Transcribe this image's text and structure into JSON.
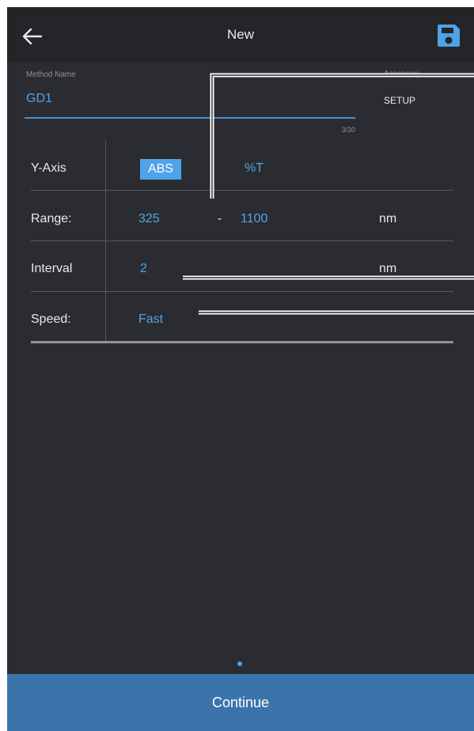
{
  "appbar": {
    "title": "New",
    "back_icon": "arrow-left-icon",
    "save_icon": "save-icon"
  },
  "method_name": {
    "label": "Method Name",
    "value": "GD1",
    "counter": "3/30"
  },
  "accessory": {
    "label": "Accessory",
    "value": "SETUP"
  },
  "rows": {
    "y_axis": {
      "label": "Y-Axis",
      "option_abs": "ABS",
      "option_t": "%T",
      "selected": "ABS"
    },
    "range": {
      "label": "Range:",
      "start": "325",
      "separator": "-",
      "end": "1100",
      "unit": "nm"
    },
    "interval": {
      "label": "Interval",
      "value": "2",
      "unit": "nm"
    },
    "speed": {
      "label": "Speed:",
      "value": "Fast"
    }
  },
  "footer": {
    "continue_label": "Continue"
  },
  "colors": {
    "background": "#2b2c31",
    "appbar": "#242529",
    "accent": "#4fa3e8",
    "continue_bar": "#3b74aa"
  }
}
